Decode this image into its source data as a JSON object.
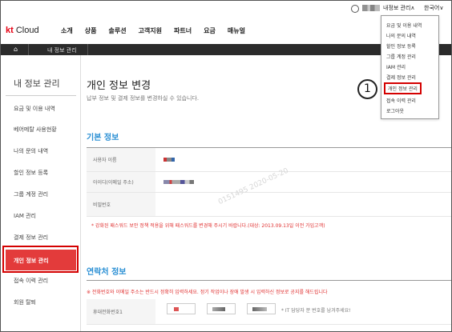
{
  "util": {
    "mypage": "내정보 관리∧",
    "lang": "한국어∨"
  },
  "logo": {
    "kt": "kt",
    "cloud": " Cloud"
  },
  "nav": [
    "소개",
    "상품",
    "솔루션",
    "고객지원",
    "파트너",
    "요금",
    "매뉴얼"
  ],
  "breadcrumb": {
    "home_icon": "home-icon",
    "current": "내 정보 관리"
  },
  "sidebar": {
    "title": "내 정보 관리",
    "items": [
      {
        "label": "요금 및 이용 내역"
      },
      {
        "label": "베어메탈 사용현황"
      },
      {
        "label": "나의 문의 내역"
      },
      {
        "label": "할인 정보 등록"
      },
      {
        "label": "그룹 계정 관리"
      },
      {
        "label": "IAM 관리"
      },
      {
        "label": "결제 정보 관리"
      },
      {
        "label": "개인 정보 관리"
      },
      {
        "label": "접속 이력 관리"
      },
      {
        "label": "회원 탈퇴"
      }
    ]
  },
  "page": {
    "title": "개인 정보 변경",
    "subtitle": "납부 정보 및 결제 정보를 변경하실 수 있습니다."
  },
  "basic": {
    "title": "기본 정보",
    "rows": [
      {
        "label": "사용자 이름"
      },
      {
        "label": "아이디(이메일 주소)"
      },
      {
        "label": "비밀번호"
      }
    ],
    "note": "* 강화된 패스워드 보안 정책 적용을 위해 패스워드를 변경해 주시기 바랍니다.(대상: 2013.09.13일 이전 가입고객)"
  },
  "watermark": "0151495   2020-05-20",
  "contact": {
    "title": "연락처 정보",
    "note": "※ 전화번호와 이메일 주소는 반드시 정확히 입력하세요. 정기 작업이나 장애 발생 시 입력하신 정보로 공지를 해드립니다",
    "row_label": "휴대전화번호1",
    "hint": "* IT 담당자 분 번호를 남겨주세요!"
  },
  "dropdown": {
    "items": [
      {
        "label": "요금 및 이용 내역"
      },
      {
        "label": "나의 문의 내역"
      },
      {
        "label": "할인 정보 등록"
      },
      {
        "label": "그룹 계정 관리"
      },
      {
        "label": "IAM 관리"
      },
      {
        "label": "결제 정보 관리"
      },
      {
        "label": "개인 정보 관리"
      },
      {
        "label": "접속 이력 관리"
      },
      {
        "label": "로그아웃"
      }
    ]
  },
  "callout": "1",
  "colors": {
    "accent_red": "#e33b3b",
    "section_blue": "#2a8fd4",
    "highlight_red": "#d40000",
    "breadcrumb_bg": "#2b2b2b"
  }
}
